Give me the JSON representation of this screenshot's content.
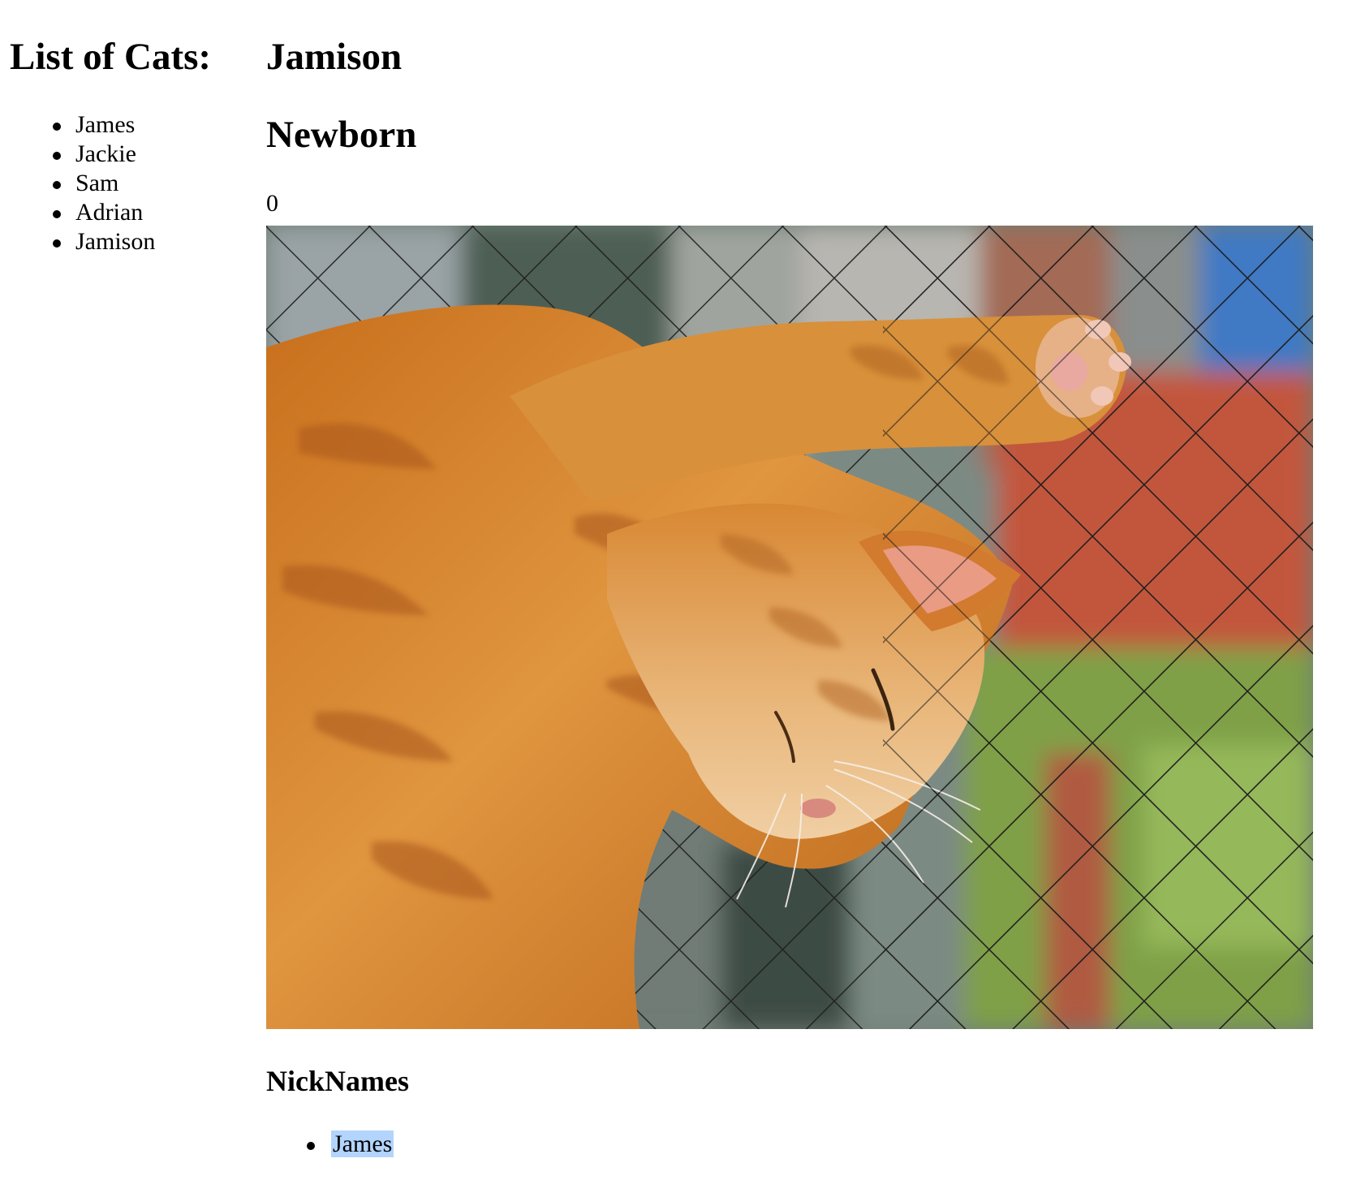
{
  "sidebar": {
    "title": "List of Cats:",
    "cats": [
      "James",
      "Jackie",
      "Sam",
      "Adrian",
      "Jamison"
    ]
  },
  "detail": {
    "name": "Jamison",
    "age": "Newborn",
    "clicks": "0",
    "nicknames_heading": "NickNames",
    "nicknames": [
      "James"
    ]
  },
  "colors": {
    "selection_highlight": "#b3d4fc",
    "cat_fur": "#d4842e",
    "fence_wire": "#1e1e1e"
  }
}
